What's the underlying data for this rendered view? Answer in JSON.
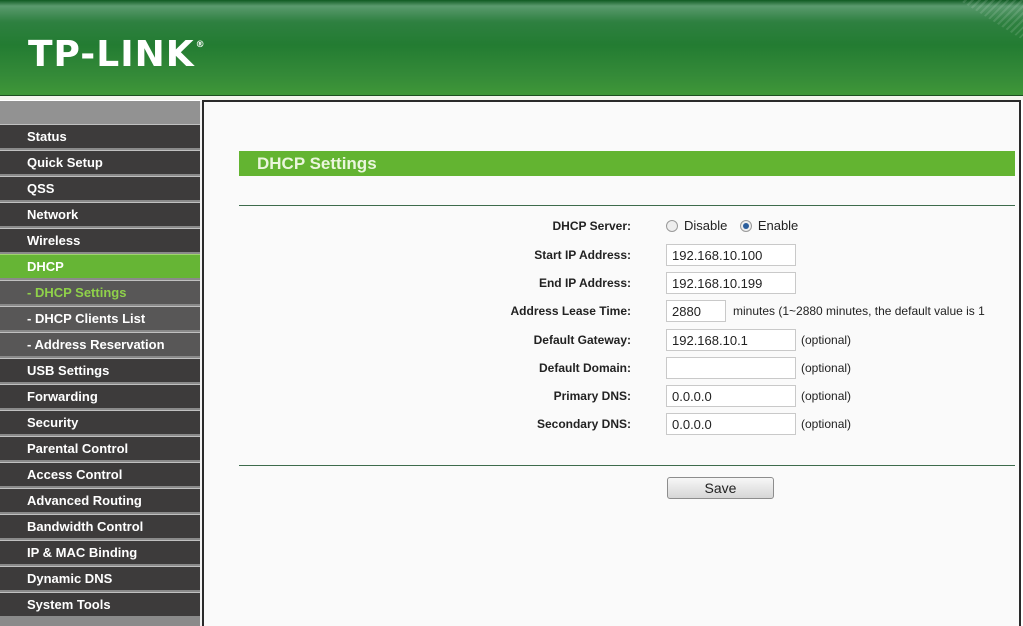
{
  "header": {
    "logo": "TP-LINK",
    "logo_mark": "®"
  },
  "sidebar": {
    "items": [
      {
        "label": "Status"
      },
      {
        "label": "Quick Setup"
      },
      {
        "label": "QSS"
      },
      {
        "label": "Network"
      },
      {
        "label": "Wireless"
      },
      {
        "label": "DHCP"
      },
      {
        "label": "- DHCP Settings"
      },
      {
        "label": "- DHCP Clients List"
      },
      {
        "label": "- Address Reservation"
      },
      {
        "label": "USB Settings"
      },
      {
        "label": "Forwarding"
      },
      {
        "label": "Security"
      },
      {
        "label": "Parental Control"
      },
      {
        "label": "Access Control"
      },
      {
        "label": "Advanced Routing"
      },
      {
        "label": "Bandwidth Control"
      },
      {
        "label": "IP & MAC Binding"
      },
      {
        "label": "Dynamic DNS"
      },
      {
        "label": "System Tools"
      }
    ]
  },
  "main": {
    "title": "DHCP Settings",
    "dhcp_server": {
      "label": "DHCP Server:",
      "options": [
        "Disable",
        "Enable"
      ],
      "selected": "Enable"
    },
    "start_ip": {
      "label": "Start IP Address:",
      "value": "192.168.10.100"
    },
    "end_ip": {
      "label": "End IP Address:",
      "value": "192.168.10.199"
    },
    "lease_time": {
      "label": "Address Lease Time:",
      "value": "2880",
      "note": "minutes (1~2880 minutes, the default value is 1"
    },
    "gateway": {
      "label": "Default Gateway:",
      "value": "192.168.10.1",
      "note": "(optional)"
    },
    "domain": {
      "label": "Default Domain:",
      "value": "",
      "note": "(optional)"
    },
    "primary_dns": {
      "label": "Primary DNS:",
      "value": "0.0.0.0",
      "note": "(optional)"
    },
    "secondary_dns": {
      "label": "Secondary DNS:",
      "value": "0.0.0.0",
      "note": "(optional)"
    },
    "save_label": "Save"
  },
  "colors": {
    "brand_green": "#2e8040",
    "accent_green": "#63b431",
    "nav_dark": "#3d3b3b",
    "sub_active_text": "#8fd14a"
  }
}
